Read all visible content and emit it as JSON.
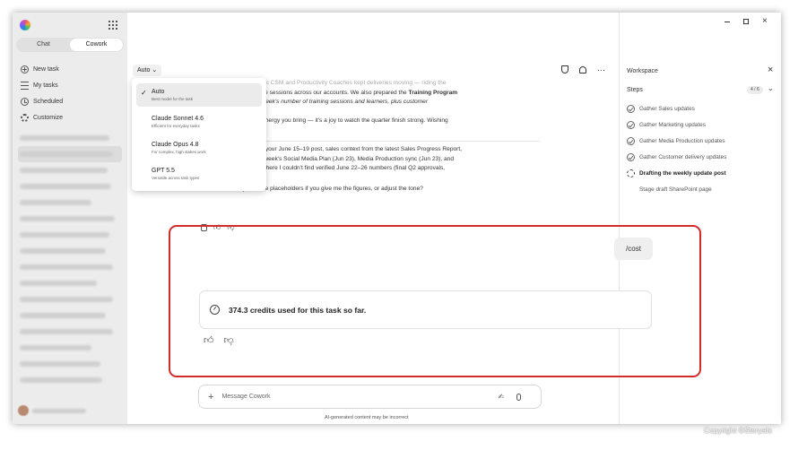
{
  "sidebar": {
    "tabs": [
      "Chat",
      "Cowork"
    ],
    "nav": [
      {
        "label": "New task",
        "icon": "plus-circle-icon"
      },
      {
        "label": "My tasks",
        "icon": "list-icon"
      },
      {
        "label": "Scheduled",
        "icon": "clock-icon"
      },
      {
        "label": "Customize",
        "icon": "gear-icon"
      }
    ]
  },
  "toolbar": {
    "model_button": "Auto ⌄"
  },
  "chat": {
    "line1": "… Amara, and our fantastic CSM and Productivity Coaches kept deliveries moving — riding the",
    "line2a": "customers and running live sessions across our accounts. We also prepared the ",
    "line2b": "Training Program",
    "line3": "d this week's number of training sessions and learners, plus customer",
    "line4": "ek. Thank you all for the energy you bring — it's a joy to watch the quarter finish strong. Wishing",
    "line5": "summer. 😊",
    "line6": "re — voice/structure from your June 15–19 post, sales context from the latest Sales Progress Report,",
    "line7": "s/delivery items from this week's Social Media Plan (Jun 23), Media Production sync (Jun 23), and",
    "line8": "brackets mark the spots where I couldn't find verified June 22–26 numbers (final Q2 approvals,",
    "line9": "n totals).",
    "question": "Want me to fill any of those placeholders if you give me the figures, or adjust the tone?"
  },
  "model_menu": [
    {
      "name": "Auto",
      "desc": "Best model for the task",
      "selected": true
    },
    {
      "name": "Claude Sonnet 4.6",
      "desc": "Efficient for everyday tasks",
      "selected": false
    },
    {
      "name": "Claude Opus 4.8",
      "desc": "For complex, high stakes work",
      "selected": false
    },
    {
      "name": "GPT 5.5",
      "desc": "Versatile across task types",
      "selected": false
    }
  ],
  "user_message": "/cost",
  "response": {
    "credits_text": "374.3 credits used for this task so far."
  },
  "composer": {
    "placeholder": "Message Cowork",
    "disclaimer": "AI-generated content may be incorrect"
  },
  "workspace": {
    "title": "Workspace",
    "steps_label": "Steps",
    "steps_count": "4 / 6",
    "steps": [
      {
        "label": "Gather Sales updates",
        "status": "done"
      },
      {
        "label": "Gather Marketing updates",
        "status": "done"
      },
      {
        "label": "Gather Media Production updates",
        "status": "done"
      },
      {
        "label": "Gather Customer delivery updates",
        "status": "done"
      },
      {
        "label": "Drafting the weekly update post",
        "status": "in-progress"
      },
      {
        "label": "Stage draft SharePoint page",
        "status": "pending"
      }
    ]
  },
  "copyright": "Copyright ©Storyals"
}
